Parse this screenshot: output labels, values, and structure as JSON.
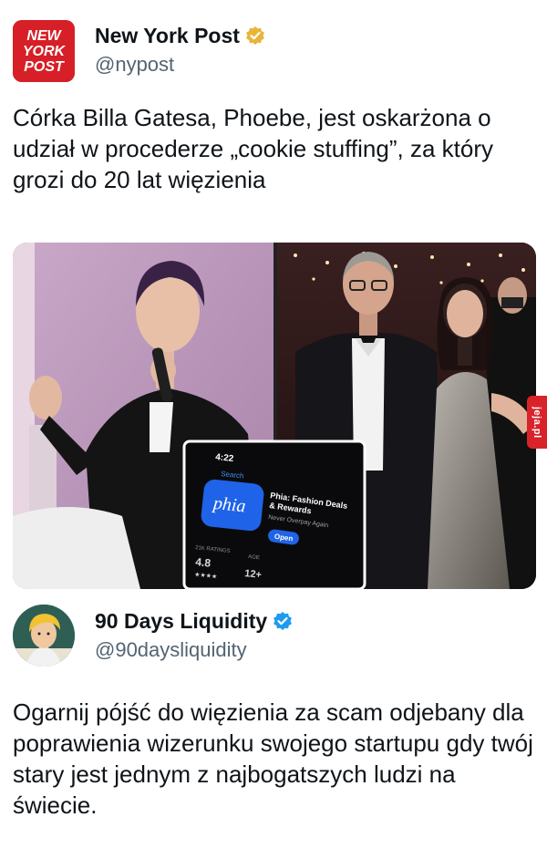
{
  "post": {
    "author_name": "New York Post",
    "author_handle": "@nypost",
    "logo_text": [
      "NEW",
      "YORK",
      "POST"
    ],
    "verified_color": "#e8b43a",
    "text": "Córka Billa Gatesa, Phoebe, jest oskarżona o udział w procederze „cookie stuffing”, za który grozi do 20 lat więzienia"
  },
  "media": {
    "inset_app": {
      "time": "4:22",
      "back_label": "Search",
      "app_icon_text": "phia",
      "app_title_line1": "Phia: Fashion Deals",
      "app_title_line2": "& Rewards",
      "app_subtitle": "Never Overpay Again",
      "open_label": "Open",
      "ratings_label": "21K RATINGS",
      "rating_value": "4.8",
      "stars": "★★★★",
      "age_label": "AGE",
      "age_value": "12+"
    }
  },
  "watermark": {
    "text": "jeja.pl",
    "color": "#d9232a"
  },
  "reply": {
    "author_name": "90 Days Liquidity",
    "author_handle": "@90daysliquidity",
    "verified_color": "#1d9bf0",
    "text": "Ogarnij pójść do więzienia za scam odjebany dla poprawienia wizerunku swojego startupu gdy twój stary jest jednym z najbogatszych ludzi na świecie."
  }
}
